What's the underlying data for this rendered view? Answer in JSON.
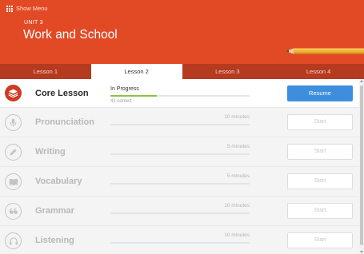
{
  "menu": {
    "label": "Show Menu",
    "icon": "grid-menu-icon"
  },
  "unit": {
    "label": "UNIT 3",
    "title": "Work and School"
  },
  "tabs": [
    {
      "label": "Lesson 1",
      "active": false
    },
    {
      "label": "Lesson 2",
      "active": true
    },
    {
      "label": "Lesson 3",
      "active": false
    },
    {
      "label": "Lesson 4",
      "active": false
    }
  ],
  "activities": [
    {
      "title": "Core Lesson",
      "icon": "layers-icon",
      "status": "In Progress",
      "sub": "41 correct",
      "progress": 0.33,
      "button": "Resume"
    },
    {
      "title": "Pronunciation",
      "icon": "microphone-icon",
      "minutes": "10 minutes",
      "progress": 0,
      "button": "Start"
    },
    {
      "title": "Writing",
      "icon": "pencil-icon",
      "minutes": "5 minutes",
      "progress": 0,
      "button": "Start"
    },
    {
      "title": "Vocabulary",
      "icon": "book-icon",
      "minutes": "5 minutes",
      "progress": 0,
      "button": "Start"
    },
    {
      "title": "Grammar",
      "icon": "quote-icon",
      "minutes": "10 minutes",
      "progress": 0,
      "button": "Start"
    },
    {
      "title": "Listening",
      "icon": "headphones-icon",
      "minutes": "10 minutes",
      "progress": 0,
      "button": "Start"
    }
  ],
  "colors": {
    "header": "#e24a26",
    "tab_bar": "#b53a1f",
    "accent_button": "#3d8fde",
    "progress": "#8bc441",
    "core_icon": "#cf3a22"
  }
}
